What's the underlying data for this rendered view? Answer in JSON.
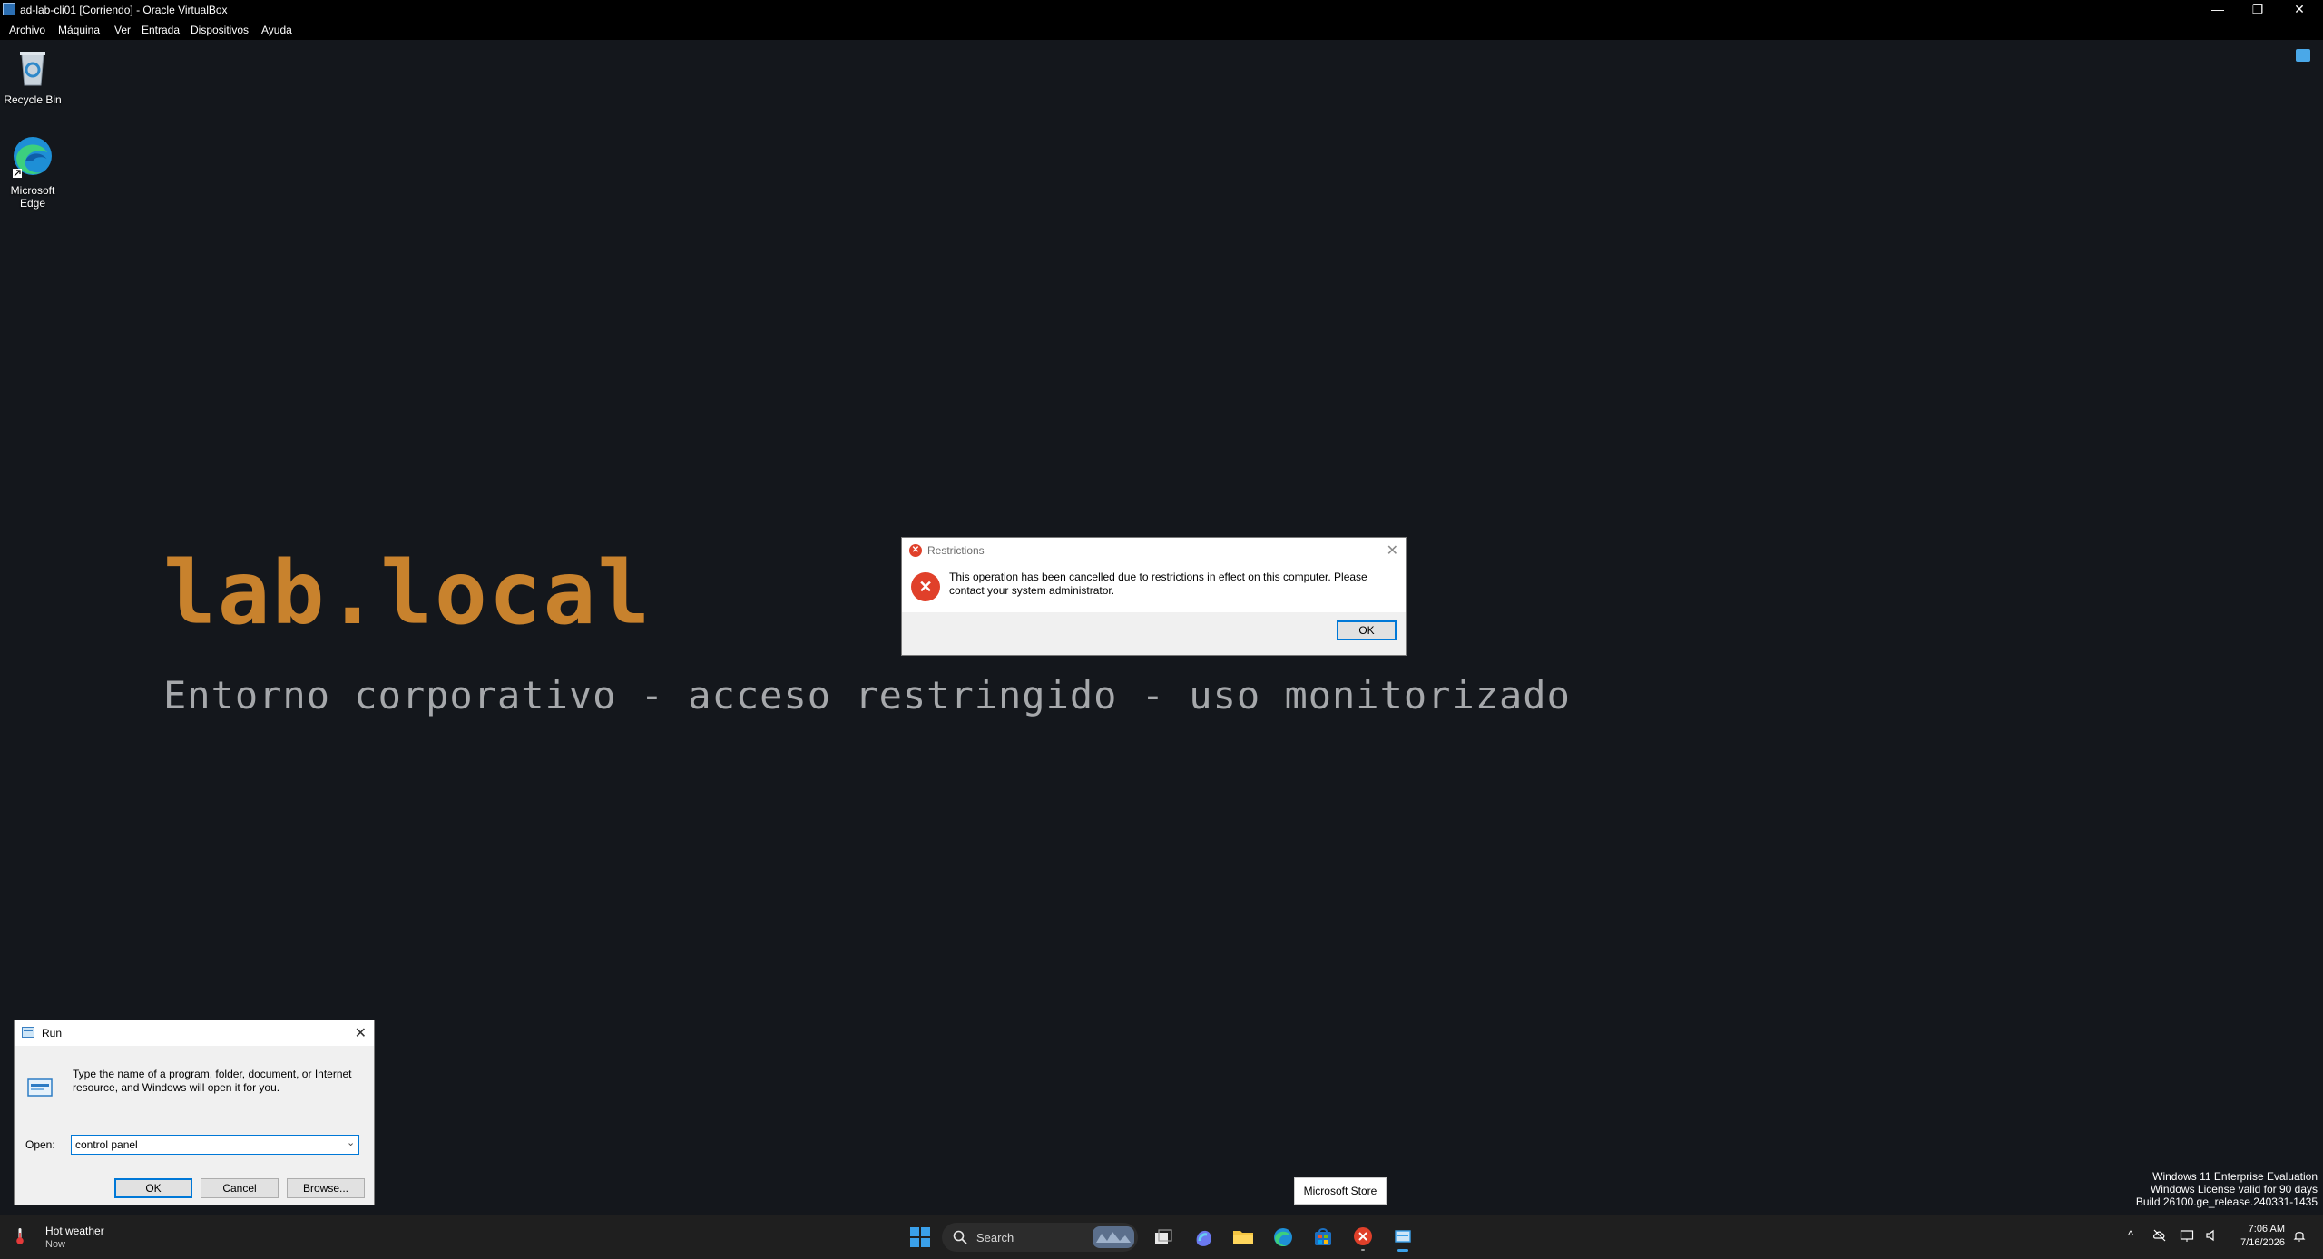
{
  "vbox": {
    "window_title": "ad-lab-cli01 [Corriendo] - Oracle VirtualBox",
    "menu": [
      "Archivo",
      "Máquina",
      "Ver",
      "Entrada",
      "Dispositivos",
      "Ayuda"
    ],
    "controls": {
      "minimize": "—",
      "restore": "❐",
      "close": "✕"
    }
  },
  "desktop": {
    "icons": [
      {
        "name": "recycle-bin",
        "label": "Recycle Bin"
      },
      {
        "name": "microsoft-edge",
        "label": "Microsoft Edge"
      }
    ],
    "brand_title": "lab.local",
    "brand_subtitle": "Entorno corporativo - acceso restringido - uso monitorizado",
    "colors": {
      "background": "#14171c",
      "brand_accent": "#c8822d",
      "subtitle": "#a6a8ab"
    }
  },
  "restrictions_dialog": {
    "title": "Restrictions",
    "message": "This operation has been cancelled due to restrictions in effect on this computer. Please contact your system administrator.",
    "ok_label": "OK",
    "close_glyph": "✕"
  },
  "run_dialog": {
    "title": "Run",
    "description": "Type the name of a program, folder, document, or Internet resource, and Windows will open it for you.",
    "open_label": "Open:",
    "open_value": "control panel",
    "ok_label": "OK",
    "cancel_label": "Cancel",
    "browse_label": "Browse...",
    "close_glyph": "✕"
  },
  "tooltip": {
    "text": "Microsoft Store"
  },
  "watermark": {
    "line1": "Windows 11 Enterprise Evaluation",
    "line2": "Windows License valid for 90 days",
    "line3": "Build 26100.ge_release.240331-1435"
  },
  "taskbar": {
    "weather_title": "Hot weather",
    "weather_sub": "Now",
    "search_placeholder": "Search",
    "apps": [
      "start",
      "search",
      "widgets",
      "task-view",
      "copilot",
      "file-explorer",
      "edge",
      "microsoft-store",
      "error-app",
      "virtualbox"
    ],
    "clock_time": "7:06 AM",
    "clock_date": "7/16/2026",
    "tray": {
      "chevron": "^"
    }
  }
}
